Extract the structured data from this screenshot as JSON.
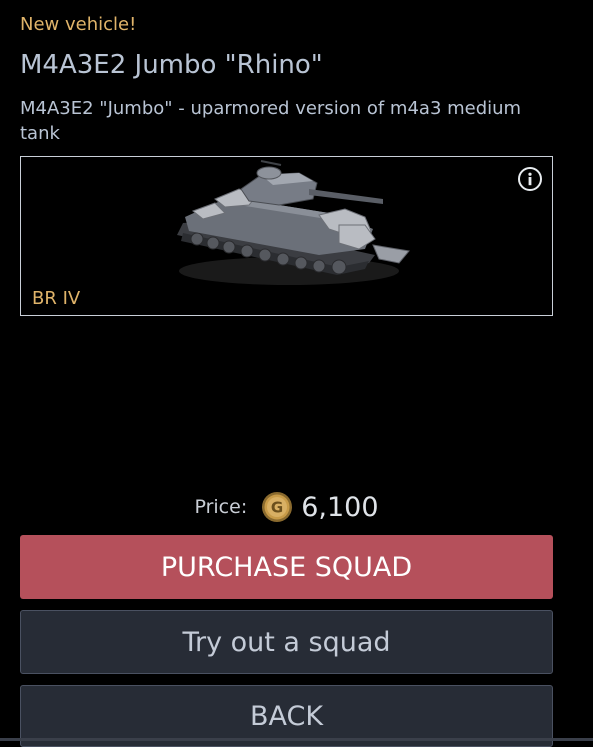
{
  "header": {
    "tag": "New vehicle!",
    "title": "M4A3E2 Jumbo \"Rhino\"",
    "description": "M4A3E2 \"Jumbo\" - uparmored version of m4a3 medium tank"
  },
  "preview": {
    "battle_rating": "BR IV",
    "info_icon": "info-icon"
  },
  "price": {
    "label": "Price:",
    "currency_icon": "gold-coin-icon",
    "value": "6,100"
  },
  "buttons": {
    "purchase": "PURCHASE SQUAD",
    "try_out": "Try out a squad",
    "back": "BACK"
  },
  "colors": {
    "accent_gold": "#e0b46a",
    "purchase_button": "#b5505b",
    "secondary_button": "#272c36"
  }
}
